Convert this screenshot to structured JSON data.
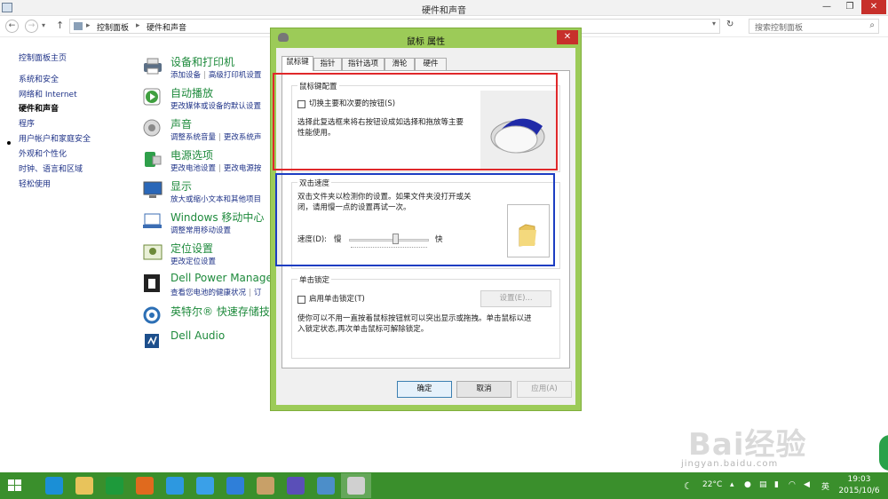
{
  "window": {
    "title": "硬件和声音",
    "controls": {
      "minimize": "—",
      "maximize": "❐",
      "close": "✕"
    }
  },
  "address": {
    "back": "←",
    "forward": "→",
    "dropdown": "▾",
    "up": "↑",
    "crumbs": [
      "控制面板",
      "硬件和声音"
    ],
    "separator": "▸",
    "refresh": "↻",
    "search_placeholder": "搜索控制面板",
    "search_icon": "⌕"
  },
  "leftnav": {
    "items": [
      "控制面板主页",
      "系统和安全",
      "网络和 Internet",
      "硬件和声音",
      "程序",
      "用户帐户和家庭安全",
      "外观和个性化",
      "时钟、语言和区域",
      "轻松使用"
    ]
  },
  "categories": [
    {
      "title": "设备和打印机",
      "links": [
        "添加设备",
        "高级打印机设置"
      ],
      "icon": "printer-icon",
      "color": "#5b6f86"
    },
    {
      "title": "自动播放",
      "links": [
        "更改媒体或设备的默认设置"
      ],
      "icon": "autoplay-icon",
      "color": "#3f9f3f"
    },
    {
      "title": "声音",
      "links": [
        "调整系统音量",
        "更改系统声"
      ],
      "icon": "speaker-icon",
      "color": "#9a9a9a"
    },
    {
      "title": "电源选项",
      "links": [
        "更改电池设置",
        "更改电源按"
      ],
      "icon": "power-icon",
      "color": "#2f9f4a"
    },
    {
      "title": "显示",
      "links": [
        "放大或缩小文本和其他项目"
      ],
      "icon": "display-icon",
      "color": "#2a67b8"
    },
    {
      "title": "Windows 移动中心",
      "links": [
        "调整常用移动设置"
      ],
      "icon": "mobility-icon",
      "color": "#3b6db3"
    },
    {
      "title": "定位设置",
      "links": [
        "更改定位设置"
      ],
      "icon": "location-icon",
      "color": "#6d8a3a"
    },
    {
      "title": "Dell Power Manager",
      "links": [
        "查看您电池的健康状况",
        "订"
      ],
      "icon": "dell-power-icon",
      "color": "#222222"
    },
    {
      "title": "英特尔® 快速存储技术",
      "links": [],
      "icon": "intel-rst-icon",
      "color": "#2c6fb5"
    },
    {
      "title": "Dell Audio",
      "links": [],
      "icon": "dell-audio-icon",
      "color": "#1d4f8c"
    }
  ],
  "dialog": {
    "title": "鼠标 属性",
    "close": "✕",
    "tabs": [
      "鼠标键",
      "指针",
      "指针选项",
      "滑轮",
      "硬件"
    ],
    "button_config": {
      "group_title": "鼠标键配置",
      "checkbox_label": "切换主要和次要的按钮(S)",
      "description": [
        "选择此复选框来将右按钮设成如选择和拖放等主要",
        "性能使用。"
      ]
    },
    "double_click": {
      "group_title": "双击速度",
      "description": [
        "双击文件夹以检测你的设置。如果文件夹没打开或关",
        "闭，请用慢一点的设置再试一次。"
      ],
      "speed_label": "速度(D):",
      "slow": "慢",
      "fast": "快",
      "slider_position": 0.58
    },
    "click_lock": {
      "group_title": "单击锁定",
      "checkbox_label": "启用单击锁定(T)",
      "settings_button": "设置(E)...",
      "description": [
        "使你可以不用一直按着鼠标按钮就可以突出显示或拖拽。单击鼠标以进",
        "入锁定状态,再次单击鼠标可解除锁定。"
      ]
    },
    "buttons": {
      "ok": "确定",
      "cancel": "取消",
      "apply": "应用(A)"
    }
  },
  "watermark": {
    "brand": "Bai经验",
    "url": "jingyan.baidu.com"
  },
  "taskbar": {
    "apps": [
      {
        "name": "ie-icon",
        "color": "#1b8fd6"
      },
      {
        "name": "file-explorer-icon",
        "color": "#e8c35b"
      },
      {
        "name": "store-icon",
        "color": "#1e9a3b"
      },
      {
        "name": "browser-icon",
        "color": "#e06a1e"
      },
      {
        "name": "360-browser-icon",
        "color": "#2d98e0"
      },
      {
        "name": "cloud-icon",
        "color": "#3aa0e8"
      },
      {
        "name": "link-icon",
        "color": "#2f7fd9"
      },
      {
        "name": "paint-icon",
        "color": "#c8a068"
      },
      {
        "name": "settings-app-icon",
        "color": "#5a4fb8"
      },
      {
        "name": "control-panel-icon",
        "color": "#4c8ec9"
      },
      {
        "name": "mouse-app-icon",
        "color": "#d0d0d0"
      }
    ],
    "temperature": "22°C",
    "ime": "英",
    "time": "19:03",
    "date": "2015/10/6"
  }
}
